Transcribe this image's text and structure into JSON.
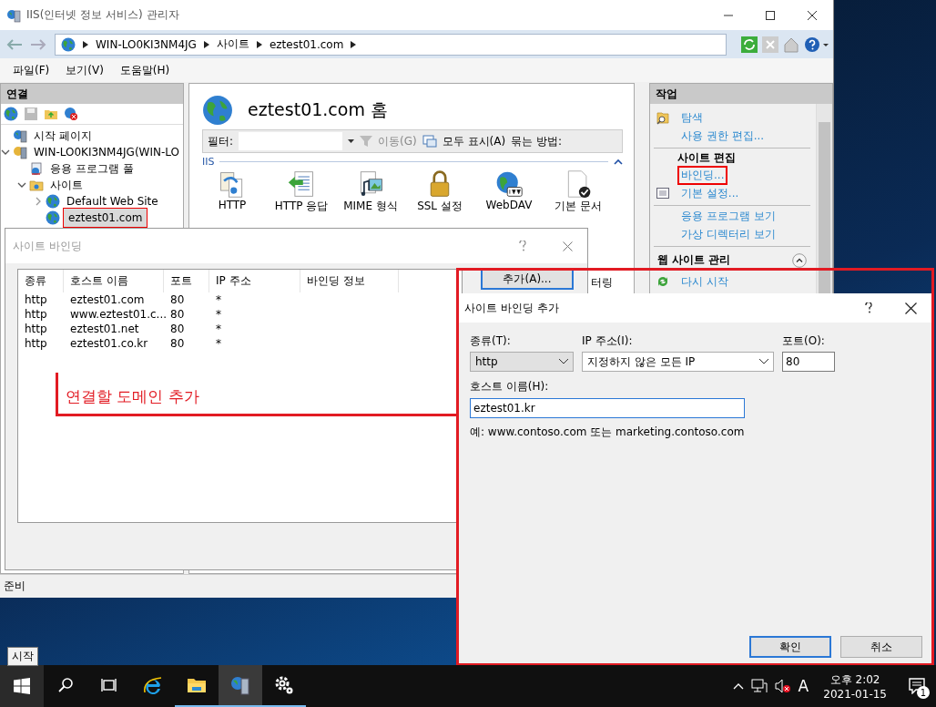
{
  "main_window": {
    "title": "IIS(인터넷 정보 서비스) 관리자",
    "breadcrumb": [
      "WIN-LO0KI3NM4JG",
      "사이트",
      "eztest01.com"
    ],
    "menu": [
      "파일(F)",
      "보기(V)",
      "도움말(H)"
    ],
    "connections": {
      "title": "연결",
      "tree": [
        {
          "label": "시작 페이지",
          "kind": "start",
          "selected": false,
          "highlighted": false
        },
        {
          "label": "WIN-LO0KI3NM4JG(WIN-LO",
          "kind": "server",
          "expanded": true,
          "selected": false,
          "highlighted": false,
          "children": [
            {
              "label": "응용 프로그램 풀",
              "kind": "pool",
              "selected": false,
              "highlighted": false
            },
            {
              "label": "사이트",
              "kind": "folder",
              "expanded": true,
              "selected": false,
              "highlighted": false,
              "children": [
                {
                  "label": "Default Web Site",
                  "kind": "site",
                  "expanded": false,
                  "selected": false,
                  "highlighted": false
                },
                {
                  "label": "eztest01.com",
                  "kind": "site",
                  "selected": true,
                  "highlighted": true
                }
              ]
            }
          ]
        }
      ]
    },
    "home_title": "eztest01.com 홈",
    "filter_bar": {
      "label": "필터:",
      "go": "이동(G)",
      "show_all": "모두 표시(A)",
      "group_by": "묶는 방법:"
    },
    "group": "IIS",
    "features": [
      {
        "label": "HTTP",
        "kind": "redirect"
      },
      {
        "label": "HTTP 응답",
        "kind": "response"
      },
      {
        "label": "MIME 형식",
        "kind": "mime"
      },
      {
        "label": "SSL 설정",
        "kind": "lock"
      },
      {
        "label": "WebDAV",
        "kind": "webdav"
      },
      {
        "label": "기본 문서",
        "kind": "document"
      }
    ],
    "partial_feature": "터링",
    "actions": {
      "title": "작업",
      "sections": [
        {
          "items": [
            {
              "label": "탐색",
              "kind": "explore",
              "highlighted": false
            },
            {
              "label": "사용 권한 편집...",
              "highlighted": false
            }
          ]
        },
        {
          "title": "사이트 편집",
          "items": [
            {
              "label": "바인딩...",
              "highlighted": true
            },
            {
              "label": "기본 설정...",
              "kind": "settings",
              "highlighted": false
            }
          ]
        },
        {
          "items": [
            {
              "label": "응용 프로그램 보기",
              "highlighted": false
            },
            {
              "label": "가상 디렉터리 보기",
              "highlighted": false
            }
          ]
        }
      ],
      "manage": {
        "title": "웹 사이트 관리",
        "expanded": true,
        "items": [
          {
            "label": "다시 시작",
            "kind": "restart"
          }
        ]
      }
    },
    "status_bar": "준비"
  },
  "bindings_dialog": {
    "title": "사이트 바인딩",
    "columns": [
      "종류",
      "호스트 이름",
      "포트",
      "IP 주소",
      "바인딩 정보"
    ],
    "rows": [
      [
        "http",
        "eztest01.com",
        "80",
        "*"
      ],
      [
        "http",
        "www.eztest01.c...",
        "80",
        "*"
      ],
      [
        "http",
        "eztest01.net",
        "80",
        "*"
      ],
      [
        "http",
        "eztest01.co.kr",
        "80",
        "*"
      ]
    ],
    "add_button": "추가(A)..."
  },
  "annotation": "연결할 도메인 추가",
  "add_dialog": {
    "title": "사이트 바인딩 추가",
    "type_label": "종류(T):",
    "type_value": "http",
    "ip_label": "IP 주소(I):",
    "ip_value": "지정하지 않은 모든 IP",
    "port_label": "포트(O):",
    "port_value": "80",
    "host_label": "호스트 이름(H):",
    "host_value": "eztest01.kr",
    "example": "예: www.contoso.com 또는 marketing.contoso.com",
    "ok": "확인",
    "cancel": "취소"
  },
  "taskbar": {
    "tooltip": "시작",
    "apps": [
      {
        "kind": "search",
        "running": false,
        "selected": false
      },
      {
        "kind": "taskview",
        "running": false,
        "selected": false
      },
      {
        "kind": "browser",
        "running": false,
        "selected": false
      },
      {
        "kind": "folder",
        "running": true,
        "selected": false
      },
      {
        "kind": "iis",
        "running": true,
        "selected": true
      },
      {
        "kind": "gear",
        "running": true,
        "selected": false
      }
    ],
    "input_indicator": "A",
    "time": "오후 2:02",
    "date": "2021-01-15",
    "notifications": "1"
  }
}
